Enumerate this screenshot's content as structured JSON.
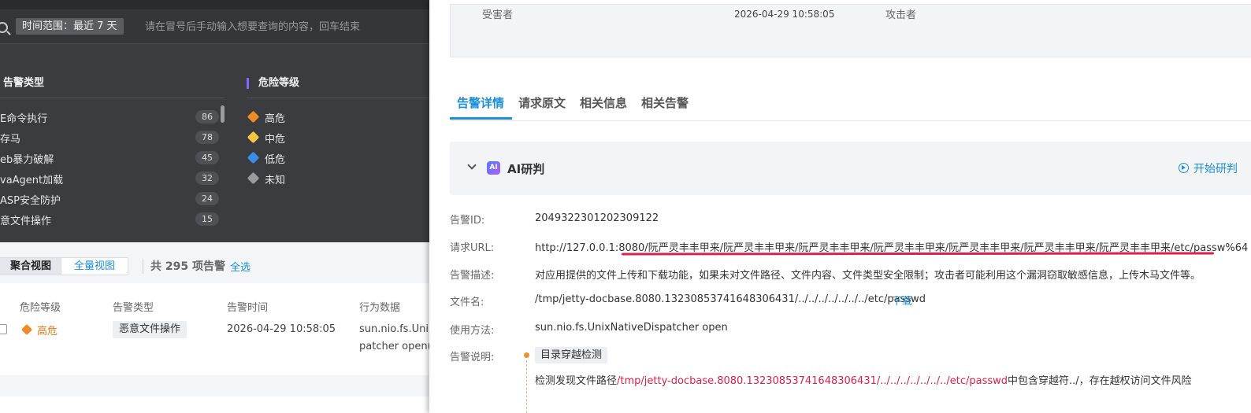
{
  "search": {
    "time_tag": "时间范围：最近 7 天",
    "placeholder": "请在冒号后手动输入想要查询的内容，回车结束"
  },
  "filters": {
    "types_title": "告警类型",
    "risk_title": "危险等级",
    "types": [
      {
        "label": "E命令执行",
        "count": "86"
      },
      {
        "label": "存马",
        "count": "78"
      },
      {
        "label": "eb暴力破解",
        "count": "45"
      },
      {
        "label": "vaAgent加载",
        "count": "32"
      },
      {
        "label": "ASP安全防护",
        "count": "24"
      },
      {
        "label": "意文件操作",
        "count": "15"
      }
    ],
    "risks": [
      {
        "label": "高危",
        "color": "#f08a24"
      },
      {
        "label": "中危",
        "color": "#f5c542"
      },
      {
        "label": "低危",
        "color": "#3a8ee6"
      },
      {
        "label": "未知",
        "color": "#9a9a9f"
      }
    ]
  },
  "list": {
    "view_aggregate": "聚合视图",
    "view_full": "全量视图",
    "total": "共 295 项告警",
    "select_all": "全选",
    "columns": [
      "危险等级",
      "告警类型",
      "告警时间",
      "行为数据"
    ],
    "row": {
      "risk": "高危",
      "type": "恶意文件操作",
      "time": "2026-04-29 10:58:05",
      "behavior_1": "sun.nio.fs.UnixN",
      "behavior_2": "patcher open(/t"
    }
  },
  "detail": {
    "victim_label": "受害者",
    "attacker_label": "攻击者",
    "time": "2026-04-29 10:58:05",
    "tabs": [
      "告警详情",
      "请求原文",
      "相关信息",
      "相关告警"
    ],
    "ai": {
      "badge": "AI",
      "title": "AI研判",
      "start": "开始研判"
    },
    "fields": {
      "alert_id_label": "告警ID:",
      "alert_id": "2049322301202309122",
      "url_label": "请求URL:",
      "url": "http://127.0.0.1:8080/阮严灵丰丰甲来/阮严灵丰丰甲来/阮严灵丰丰甲来/阮严灵丰丰甲来/阮严灵丰丰甲来/阮严灵丰丰甲来/阮严灵丰丰甲来/etc/passw%64",
      "desc_label": "告警描述:",
      "desc": "对应用提供的文件上传和下载功能，如果未对文件路径、文件内容、文件类型安全限制；攻击者可能利用这个漏洞窃取敏感信息，上传木马文件等。",
      "filename_label": "文件名:",
      "filename": "/tmp/jetty-docbase.8080.13230853741648306431/../../../../../../../etc/passwd",
      "download": "下载",
      "method_label": "使用方法:",
      "method": "sun.nio.fs.UnixNativeDispatcher open",
      "explain_label": "告警说明:",
      "rule_tag": "目录穿越检测",
      "detect_prefix": "检测发现文件路径",
      "detect_path": "/tmp/jetty-docbase.8080.13230853741648306431/../../../../../../../etc/passwd",
      "detect_suffix": "中包含穿越符../，存在越权访问文件风险"
    }
  }
}
